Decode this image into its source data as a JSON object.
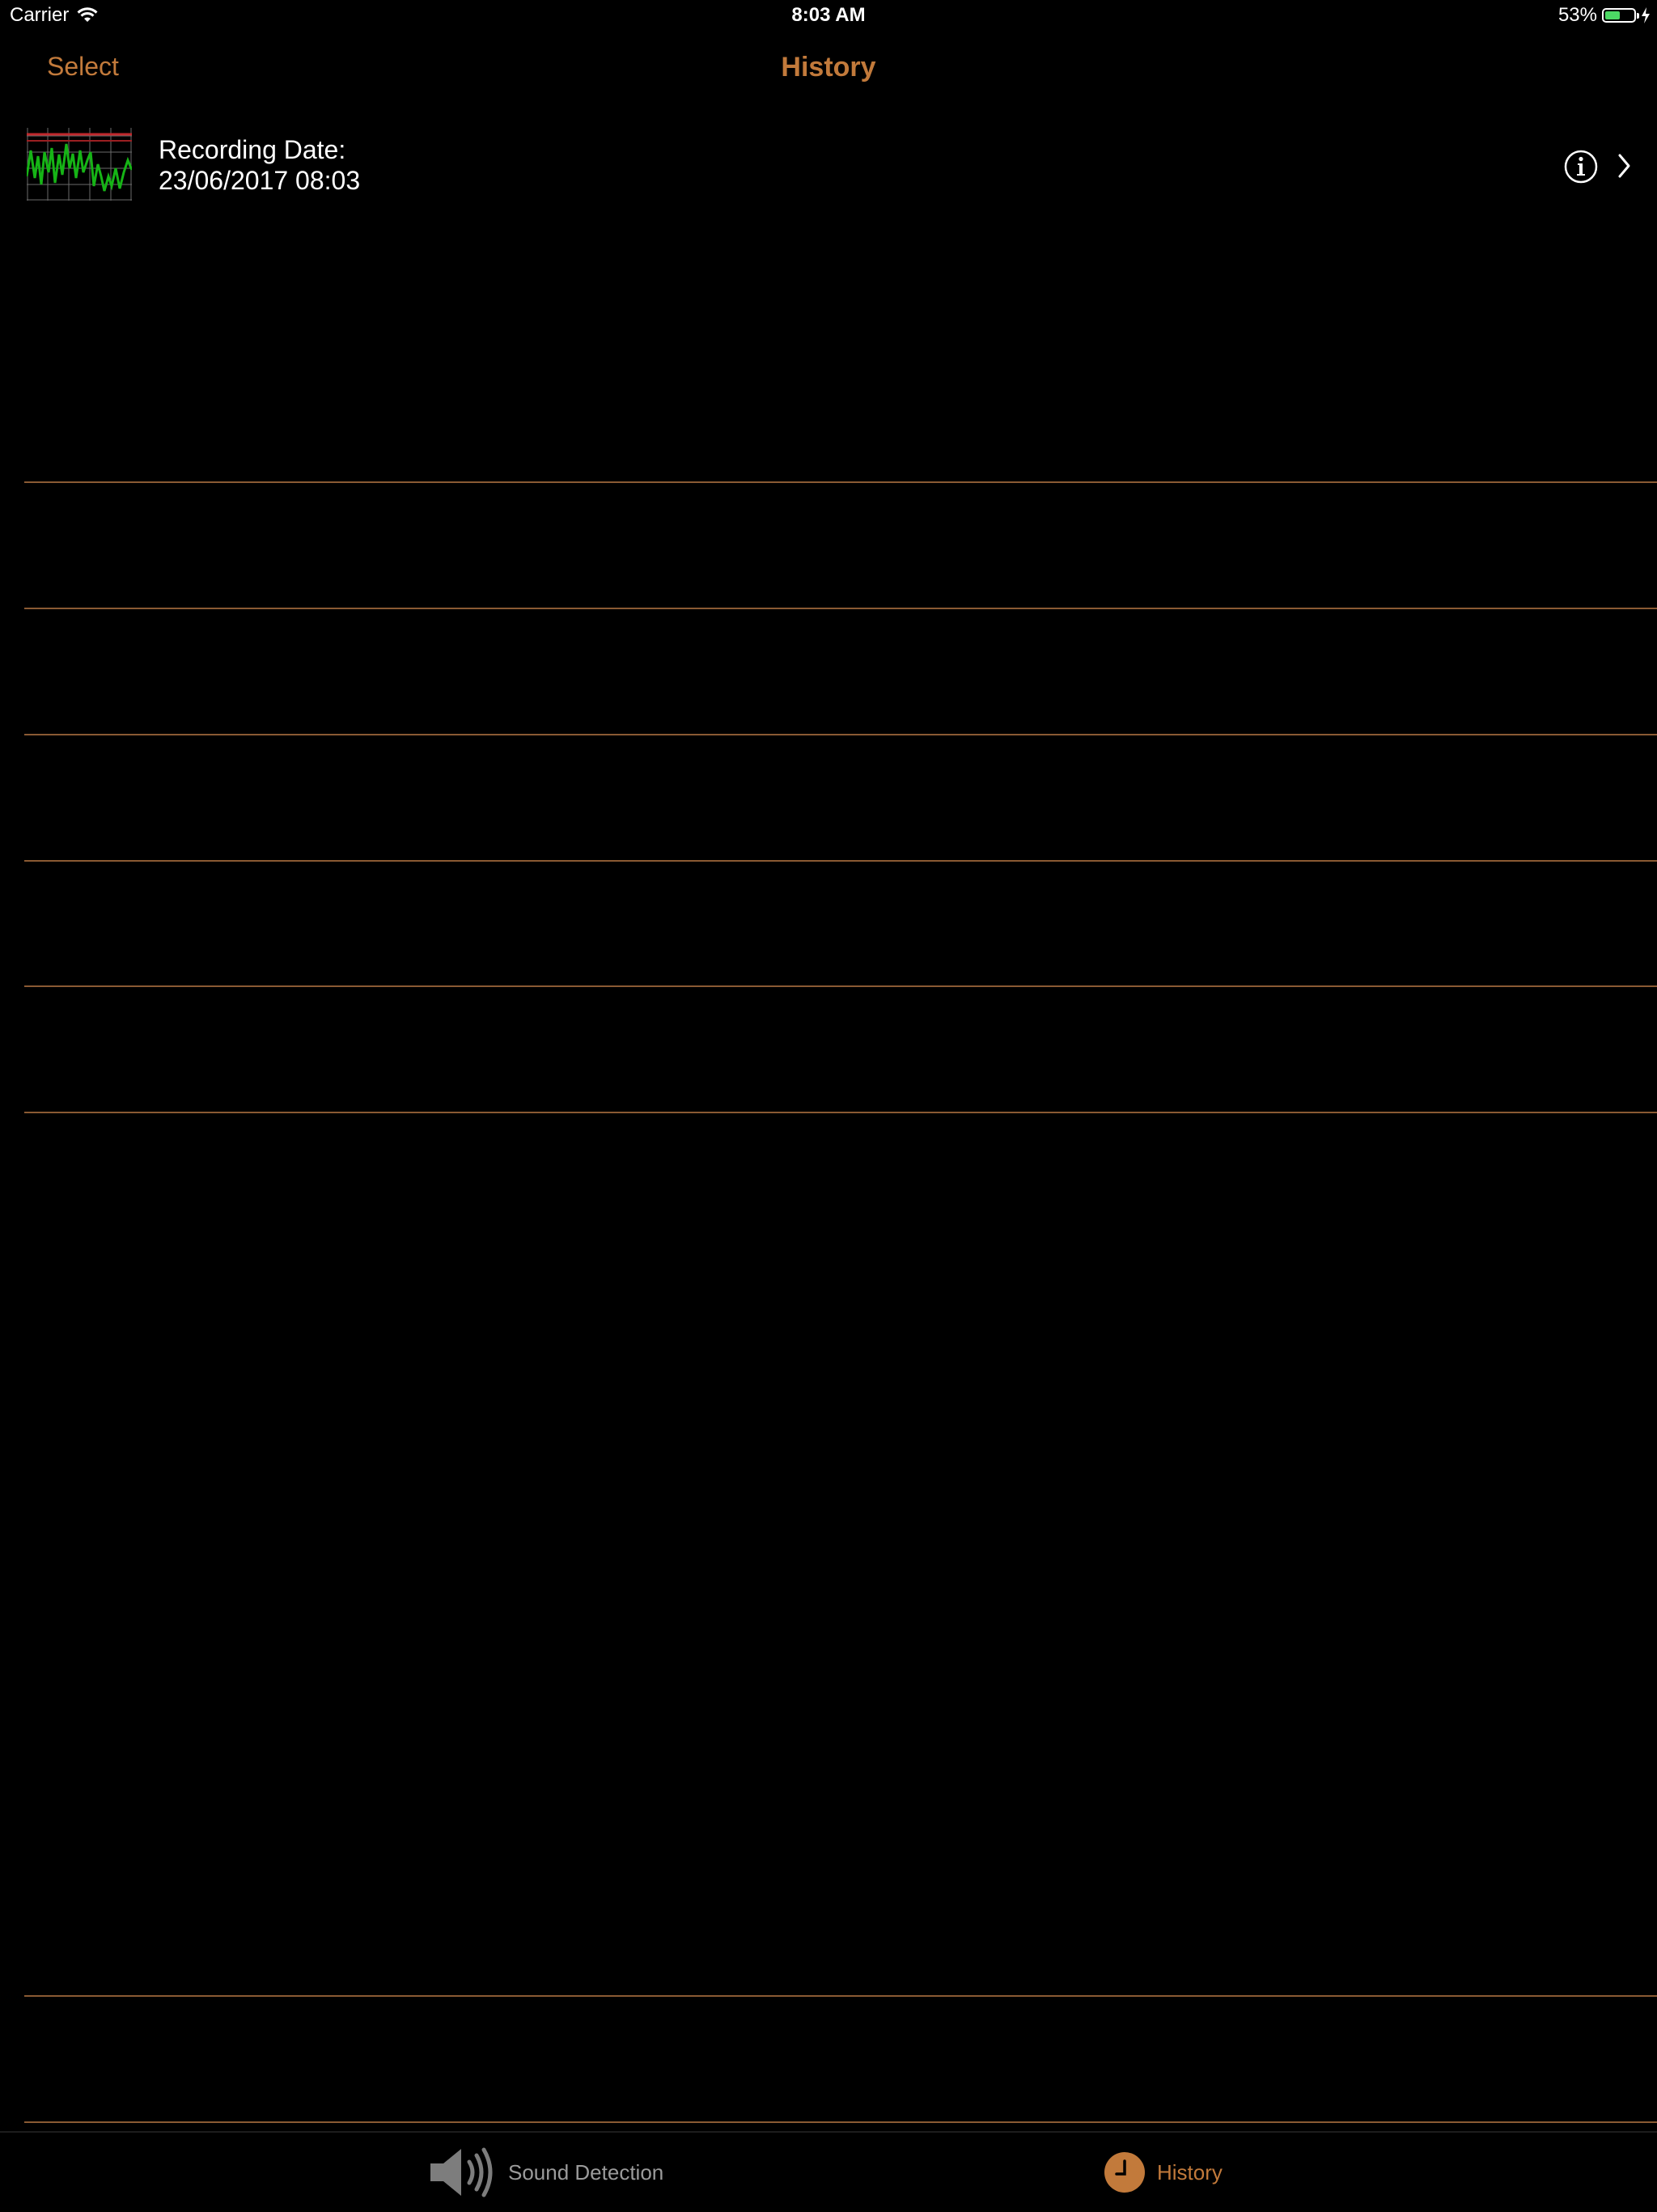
{
  "status_bar": {
    "carrier": "Carrier",
    "time": "8:03 AM",
    "battery_percent_label": "53%",
    "battery_level": 0.53
  },
  "nav": {
    "select_label": "Select",
    "title": "History"
  },
  "records": [
    {
      "label": "Recording Date:",
      "date": "23/06/2017 08:03"
    }
  ],
  "tabs": [
    {
      "label": "Sound Detection",
      "icon": "speaker-icon",
      "selected": false
    },
    {
      "label": "History",
      "icon": "clock-icon",
      "selected": true
    }
  ],
  "colors": {
    "accent": "#c27a3b",
    "separator": "#8a5a33",
    "tab_inactive": "#9b9b9b",
    "background": "#000000",
    "waveform": "#16b416"
  }
}
